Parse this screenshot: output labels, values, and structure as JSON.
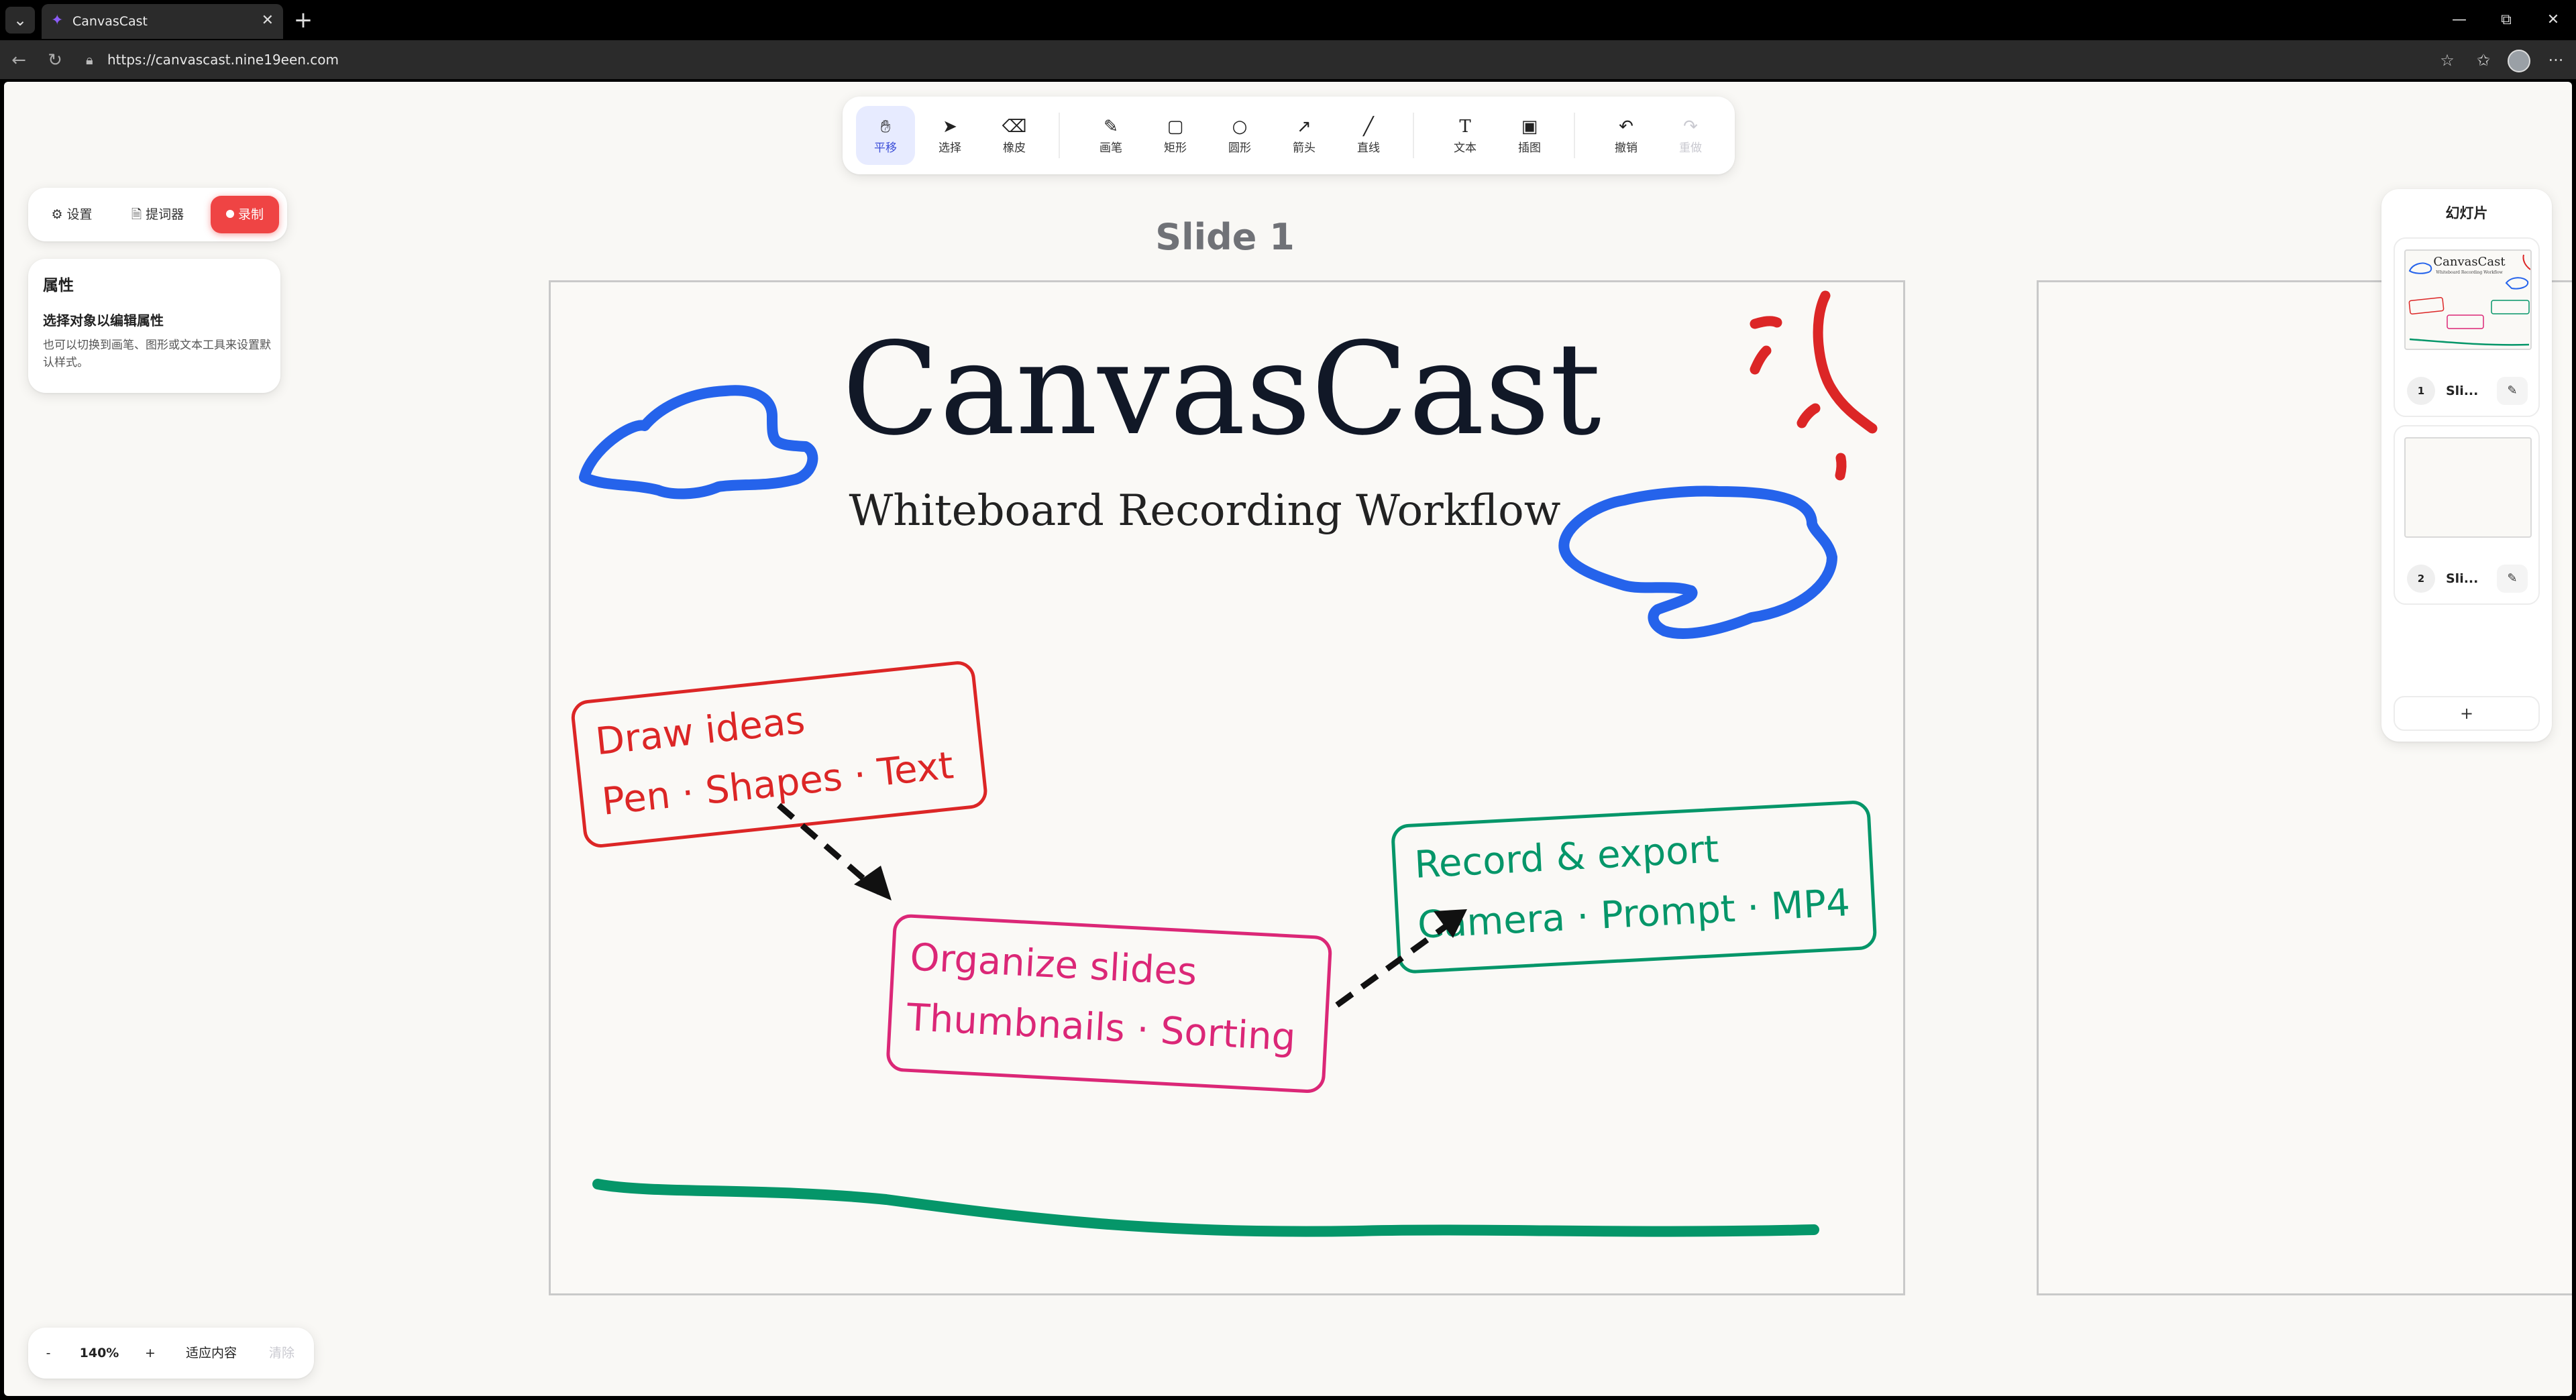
{
  "browser": {
    "tab_title": "CanvasCast",
    "url": "https://canvascast.nine19een.com",
    "icons": {
      "tab_menu": "chevron-down-icon",
      "favicon": "canvascast-logo-icon",
      "close": "close-icon",
      "new_tab": "plus-icon",
      "back": "back-arrow-icon",
      "reload": "reload-icon",
      "lock": "lock-icon",
      "star": "star-icon",
      "favorites": "favorites-icon",
      "more": "more-icon"
    }
  },
  "toolbar": {
    "tools": [
      {
        "label": "平移",
        "icon": "hand-icon",
        "active": true
      },
      {
        "label": "选择",
        "icon": "cursor-icon"
      },
      {
        "label": "橡皮",
        "icon": "eraser-icon"
      },
      {
        "label": "画笔",
        "icon": "pen-icon"
      },
      {
        "label": "矩形",
        "icon": "rectangle-icon"
      },
      {
        "label": "圆形",
        "icon": "ellipse-icon"
      },
      {
        "label": "箭头",
        "icon": "arrow-icon"
      },
      {
        "label": "直线",
        "icon": "line-icon"
      },
      {
        "label": "文本",
        "icon": "text-icon"
      },
      {
        "label": "插图",
        "icon": "image-icon"
      },
      {
        "label": "撤销",
        "icon": "undo-icon"
      },
      {
        "label": "重做",
        "icon": "redo-icon",
        "disabled": true
      }
    ]
  },
  "top_left": {
    "settings": "设置",
    "prompter": "提词器",
    "record": "录制",
    "record_color": "#ef4444"
  },
  "properties": {
    "title": "属性",
    "subtitle": "选择对象以编辑属性",
    "hint": "也可以切换到画笔、图形或文本工具来设置默认样式。"
  },
  "canvas": {
    "slide_title": "Slide 1",
    "title": "CanvasCast",
    "subtitle": "Whiteboard Recording Workflow",
    "box1": {
      "line1": "Draw ideas",
      "line2": "Pen · Shapes · Text",
      "color": "#dc2626"
    },
    "box2": {
      "line1": "Organize slides",
      "line2": "Thumbnails · Sorting",
      "color": "#db2777"
    },
    "box3": {
      "line1": "Record & export",
      "line2": "Camera · Prompt · MP4",
      "color": "#059669"
    },
    "stroke_colors": {
      "blue": "#2563eb",
      "red": "#dc2626",
      "green": "#059669"
    }
  },
  "slides_panel": {
    "title": "幻灯片",
    "slides": [
      {
        "num": "1",
        "name": "Sli...",
        "thumb_title": "CanvasCast",
        "thumb_sub": "Whiteboard Recording Workflow"
      },
      {
        "num": "2",
        "name": "Sli..."
      }
    ],
    "add": "+"
  },
  "zoom": {
    "minus": "-",
    "level": "140%",
    "plus": "+",
    "fit": "适应内容",
    "clear": "清除"
  }
}
